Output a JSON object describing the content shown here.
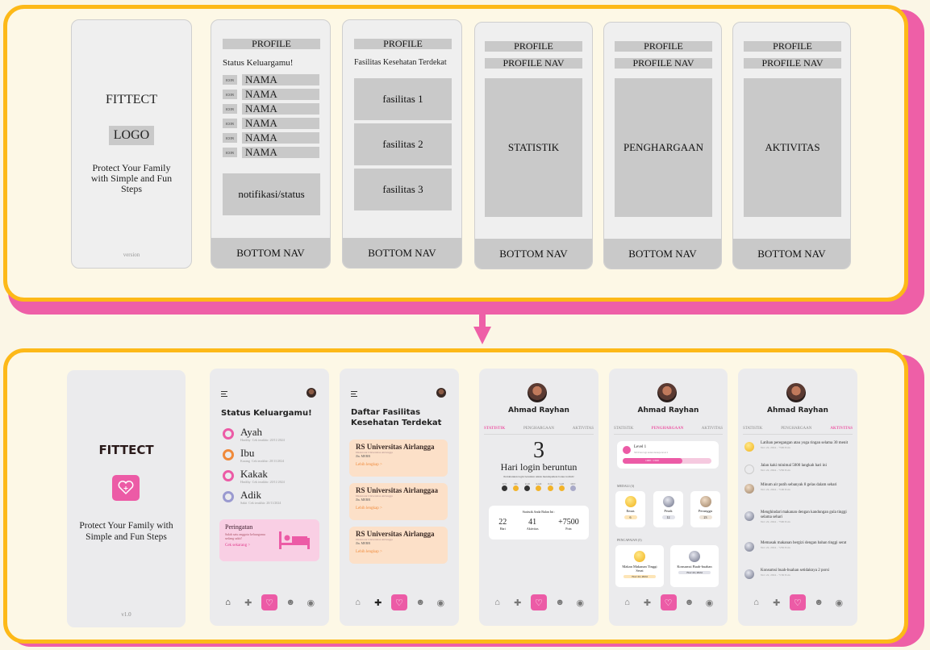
{
  "wireframes": {
    "splash": {
      "title": "FITTECT",
      "logo": "LOGO",
      "tagline": "Protect Your Family with Simple and Fun Steps",
      "version": "version"
    },
    "status": {
      "header": "PROFILE",
      "heading": "Status Keluargamu!",
      "icon_label": "ICON",
      "rows": [
        "NAMA",
        "NAMA",
        "NAMA",
        "NAMA",
        "NAMA",
        "NAMA"
      ],
      "notif": "notifikasi/status",
      "bottom_nav": "BOTTOM NAV"
    },
    "facilities": {
      "header": "PROFILE",
      "heading": "Fasilitas Kesehatan Terdekat",
      "items": [
        "fasilitas 1",
        "fasilitas 2",
        "fasilitas 3"
      ],
      "bottom_nav": "BOTTOM NAV"
    },
    "profile_stat": {
      "header": "PROFILE",
      "subheader": "PROFILE NAV",
      "content": "STATISTIK",
      "bottom_nav": "BOTTOM NAV"
    },
    "profile_award": {
      "header": "PROFILE",
      "subheader": "PROFILE NAV",
      "content": "PENGHARGAAN",
      "bottom_nav": "BOTTOM NAV"
    },
    "profile_act": {
      "header": "PROFILE",
      "subheader": "PROFILE NAV",
      "content": "AKTIVITAS",
      "bottom_nav": "BOTTOM NAV"
    }
  },
  "designs": {
    "splash": {
      "title": "FITTECT",
      "tagline": "Protect Your Family with Simple and Fun Steps",
      "version": "v1.0"
    },
    "status": {
      "heading": "Status Keluargamu!",
      "members": [
        {
          "name": "Ayah",
          "status": "Healthy",
          "date": "Cek terakhir: 20/11/2024",
          "color": "#ec5ba6"
        },
        {
          "name": "Ibu",
          "status": "Kurang",
          "date": "Cek terakhir: 20/11/2024",
          "color": "#f08a3a"
        },
        {
          "name": "Kakak",
          "status": "Healthy",
          "date": "Cek terakhir: 20/11/2024",
          "color": "#ec5ba6"
        },
        {
          "name": "Adik",
          "status": "Sakit",
          "date": "Cek terakhir: 20/11/2024",
          "color": "#9a9ad0"
        }
      ],
      "alert_title": "Peringatan",
      "alert_text": "Salah satu anggota keluargamu sedang sakit!",
      "alert_link": "Cek sekarang >"
    },
    "facilities": {
      "heading": "Daftar Fasilitas Kesehatan Terdekat",
      "items": [
        {
          "name": "RS Universitas Airlangga",
          "sub": "Direktorat Universitas Airlangga",
          "addr": "Jln. MERR",
          "link": "Lebih lengkap >"
        },
        {
          "name": "RS Universitas Airlanggaa",
          "sub": "Direktorat Universitas Airlangga",
          "addr": "Jln. MERR",
          "link": "Lebih lengkap >"
        },
        {
          "name": "RS Universitas Airlangga",
          "sub": "Direktorat Universitas Airlangga",
          "addr": "Jln. MERR",
          "link": "Lebih lengkap >"
        }
      ]
    },
    "profile": {
      "name": "Ahmad Rayhan",
      "tabs": [
        "STATISTIK",
        "PENGHARGAAN",
        "AKTIVITAS"
      ]
    },
    "stat": {
      "big_number": "3",
      "big_label": "Hari login beruntun",
      "note": "Pertahankan login beruntun untuk mendapatkan bonus lodinh!",
      "days": [
        "SEN",
        "SEL",
        "RAB",
        "KAM",
        "JUM",
        "SAB",
        "MIN"
      ],
      "summary_title": "Statistik Anda Bulan Ini :",
      "summary": [
        {
          "value": "22",
          "label": "Hari"
        },
        {
          "value": "41",
          "label": "Aktivitas"
        },
        {
          "value": "+7500",
          "label": "Poin"
        }
      ]
    },
    "award": {
      "level_label": "Level 1",
      "level_sub": "500 Poin lagi untuk menuju level 2",
      "level_pts": "1000 / 1500",
      "level_fraction": 0.67,
      "medals_title": "MEDALI (3)",
      "medals": [
        {
          "name": "Emas",
          "count": "6"
        },
        {
          "name": "Perak",
          "count": "12"
        },
        {
          "name": "Perunggu",
          "count": "23"
        }
      ],
      "achievements_title": "PENCAPAIAN (5)",
      "achievements": [
        {
          "name": "Makan Makanan Tinggi Serat",
          "date": "Nov 22, 2024"
        },
        {
          "name": "Konsumsi Buah-buahan",
          "date": "Nov 22, 2024"
        }
      ]
    },
    "activity": {
      "items": [
        {
          "text": "Latihan peregangan atau yoga ringan selama 30 menit",
          "date": "Nov 22, 2024 - +500 Poin"
        },
        {
          "text": "Jalan kaki minimal 5000 langkah hari ini",
          "date": "Nov 22, 2024 - +250 Poin"
        },
        {
          "text": "Minum air putih sebanyak 8 gelas dalam sehari",
          "date": "Nov 22, 2024 - +100 Poin"
        },
        {
          "text": "Menghindari makanan dengan kandungan gula tinggi selama sehari",
          "date": "Nov 22, 2024 - +500 Poin"
        },
        {
          "text": "Memasak makanan bergizi dengan bahan tinggi serat",
          "date": "Nov 22, 2024 - +250 Poin"
        },
        {
          "text": "Konsumsi buah-buahan setidaknya 2 porsi",
          "date": "Nov 22, 2024 - +150 Poin"
        }
      ]
    }
  },
  "colors": {
    "pink": "#ec5ba6",
    "yellow": "#fdb918",
    "cream": "#fdf8e6",
    "peach": "#fce0c8"
  }
}
